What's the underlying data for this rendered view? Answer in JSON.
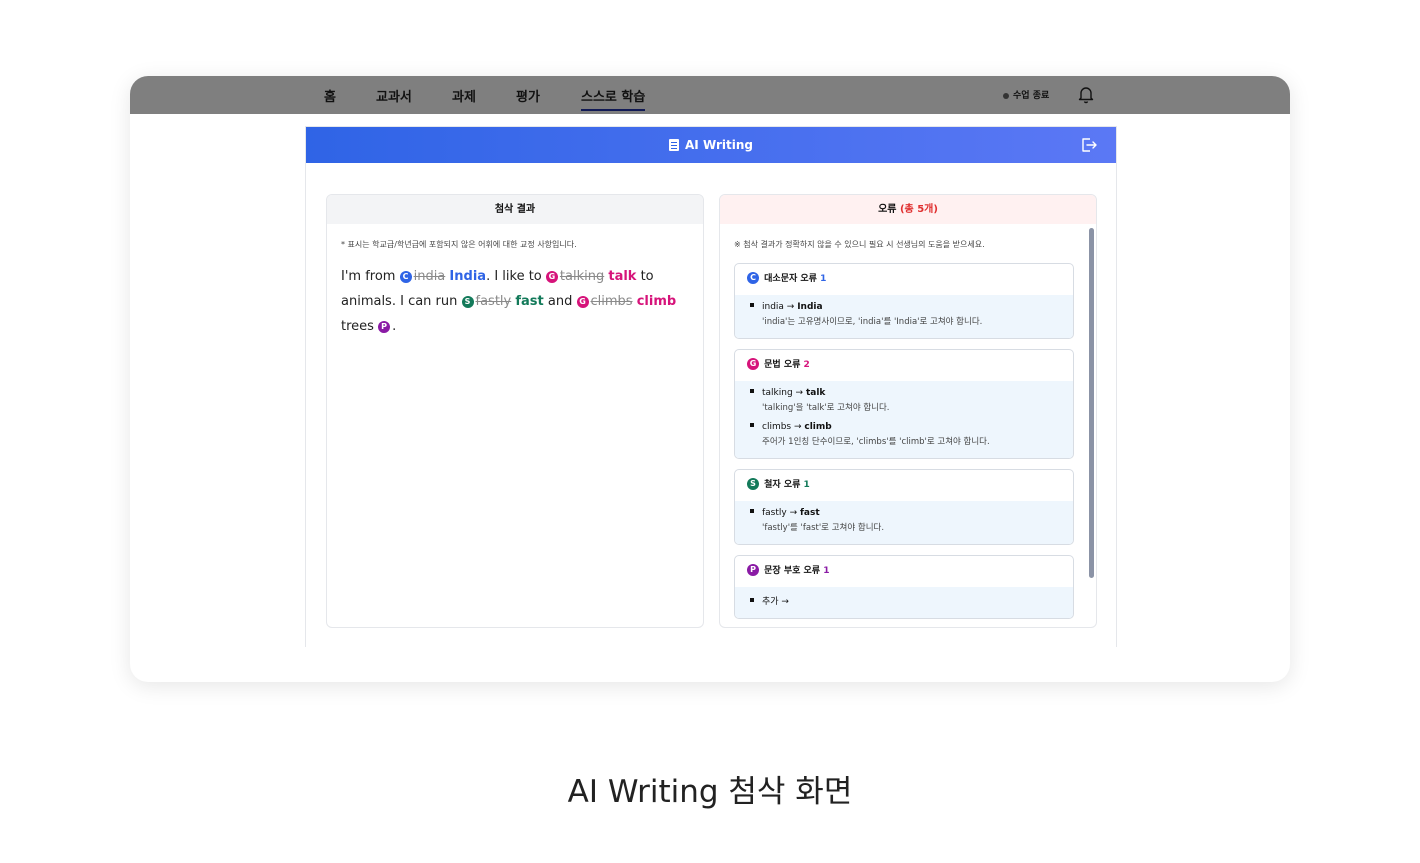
{
  "nav": {
    "items": [
      "홈",
      "교과서",
      "과제",
      "평가",
      "스스로 학습"
    ],
    "active_index": 4,
    "end_class_label": "수업 종료"
  },
  "header": {
    "title": "AI Writing"
  },
  "left_card": {
    "title": "첨삭 결과",
    "note": "* 표시는 학교급/학년급에 포함되지 않은 어휘에 대한 교정 사항입니다.",
    "essay": {
      "t1": "I'm from ",
      "c_badge": "C",
      "c_orig": "india",
      "c_fix": "India",
      "t2": ". I like to ",
      "g1_badge": "G",
      "g1_orig": "talking",
      "g1_fix": "talk",
      "t3": " to animals. I can run ",
      "s_badge": "S",
      "s_orig": "fastly",
      "s_fix": "fast",
      "t4": " and ",
      "g2_badge": "G",
      "g2_orig": "climbs",
      "g2_fix": "climb",
      "t5": " trees ",
      "p_badge": "P",
      "t6": "."
    }
  },
  "right_card": {
    "title": "오류",
    "total": "(총 5개)",
    "note": "※ 첨삭 결과가 정확하지 않을 수 있으니 필요 시 선생님의 도움을 받으세요.",
    "groups": [
      {
        "badge": "C",
        "label": "대소문자 오류",
        "count": "1",
        "items": [
          {
            "from": "india",
            "to": "India",
            "desc": "'india'는 고유명사이므로, 'india'를 'India'로 고쳐야 합니다."
          }
        ]
      },
      {
        "badge": "G",
        "label": "문법 오류",
        "count": "2",
        "items": [
          {
            "from": "talking",
            "to": "talk",
            "desc": "'talking'을 'talk'로 고쳐야 합니다."
          },
          {
            "from": "climbs",
            "to": "climb",
            "desc": "주어가 1인칭 단수이므로, 'climbs'를 'climb'로 고쳐야 합니다."
          }
        ]
      },
      {
        "badge": "S",
        "label": "철자 오류",
        "count": "1",
        "items": [
          {
            "from": "fastly",
            "to": "fast",
            "desc": "'fastly'를 'fast'로 고쳐야 합니다."
          }
        ]
      },
      {
        "badge": "P",
        "label": "문장 부호 오류",
        "count": "1",
        "items": [
          {
            "from": "추가",
            "to": "",
            "desc": ""
          }
        ]
      }
    ]
  },
  "caption": "AI Writing 첨삭 화면",
  "colors": {
    "header_start": "#2f64e6",
    "header_end": "#5b78f5",
    "capital": "#2f64e6",
    "grammar": "#d6137a",
    "spelling": "#137a5a",
    "punctuation": "#8a1aa5",
    "error_red": "#e03131"
  }
}
